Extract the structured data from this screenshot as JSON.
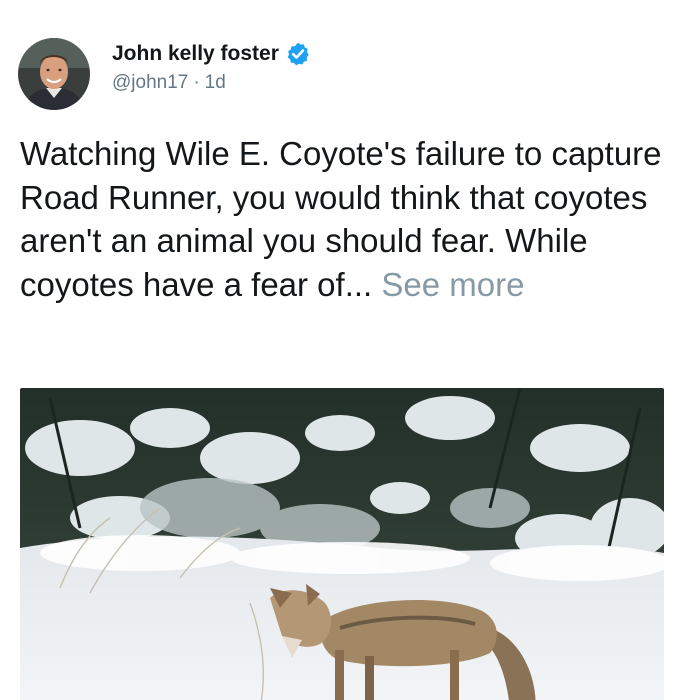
{
  "tweet": {
    "author": {
      "display_name": "John kelly foster",
      "handle": "@john17",
      "separator": "·",
      "timestamp": "1d",
      "verified": true,
      "avatar_icon": "profile-photo",
      "verified_icon": "verified-badge-icon"
    },
    "body": {
      "text": "Watching Wile E. Coyote's failure to capture Road Runner, you would think that coyotes aren't an animal you should fear. While coyotes have a fear of...",
      "see_more": "See more"
    },
    "media": {
      "type": "photo",
      "subject": "coyote-in-snow-photo"
    },
    "colors": {
      "name": "#14171a",
      "secondary": "#657786",
      "see_more": "#8899a6",
      "verified": "#1da1f2"
    }
  }
}
